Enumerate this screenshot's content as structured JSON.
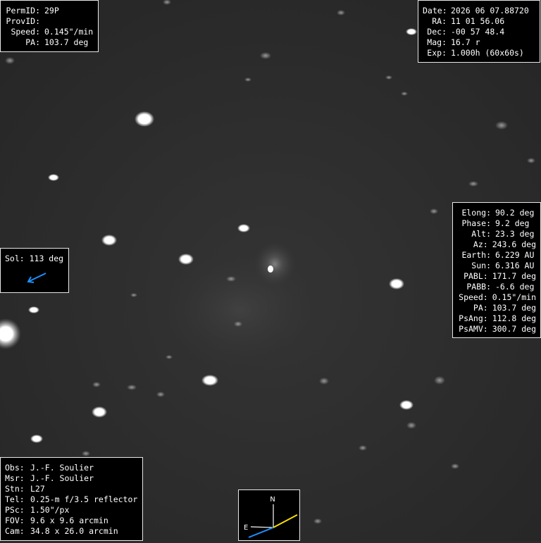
{
  "object_panel": {
    "rows": [
      {
        "label": "PermID:",
        "value": "29P"
      },
      {
        "label": "ProvID:",
        "value": ""
      },
      {
        "label": "Speed:",
        "value": "0.145\"/min"
      },
      {
        "label": "PA:",
        "value": "103.7 deg"
      }
    ]
  },
  "observation_panel": {
    "rows": [
      {
        "label": "Date:",
        "value": "2026 06 07.88720"
      },
      {
        "label": "RA:",
        "value": "11 01 56.06"
      },
      {
        "label": "Dec:",
        "value": "-00 57 48.4"
      },
      {
        "label": "Mag:",
        "value": "16.7 r"
      },
      {
        "label": "Exp:",
        "value": "1.000h (60x60s)"
      }
    ]
  },
  "geometry_panel": {
    "rows": [
      {
        "label": "Elong:",
        "value": "90.2 deg"
      },
      {
        "label": "Phase:",
        "value": "9.2 deg"
      },
      {
        "label": "Alt:",
        "value": "23.3 deg"
      },
      {
        "label": "Az:",
        "value": "243.6 deg"
      },
      {
        "label": "Earth:",
        "value": "6.229 AU"
      },
      {
        "label": "Sun:",
        "value": "6.316 AU"
      },
      {
        "label": "PABL:",
        "value": "171.7 deg"
      },
      {
        "label": "PABB:",
        "value": "-6.6 deg"
      },
      {
        "label": "Speed:",
        "value": "0.15\"/min"
      },
      {
        "label": "PA:",
        "value": "103.7 deg"
      },
      {
        "label": "PsAng:",
        "value": "112.8 deg"
      },
      {
        "label": "PsAMV:",
        "value": "300.7 deg"
      }
    ]
  },
  "sun_panel": {
    "label": "Sol: 113 deg",
    "arrow_color": "#1e90ff"
  },
  "observer_panel": {
    "rows": [
      {
        "label": "Obs:",
        "value": "J.-F. Soulier"
      },
      {
        "label": "Msr:",
        "value": "J.-F. Soulier"
      },
      {
        "label": "Stn:",
        "value": "L27"
      },
      {
        "label": "Tel:",
        "value": "0.25-m f/3.5 reflector"
      },
      {
        "label": "PSc:",
        "value": "1.50\"/px"
      },
      {
        "label": "FOV:",
        "value": "9.6 x 9.6 arcmin"
      },
      {
        "label": "Cam:",
        "value": "34.8 x 26.0 arcmin"
      }
    ]
  },
  "compass": {
    "north_label": "N",
    "east_label": "E",
    "motion_color": "#f5e000",
    "sun_color": "#1e90ff"
  }
}
